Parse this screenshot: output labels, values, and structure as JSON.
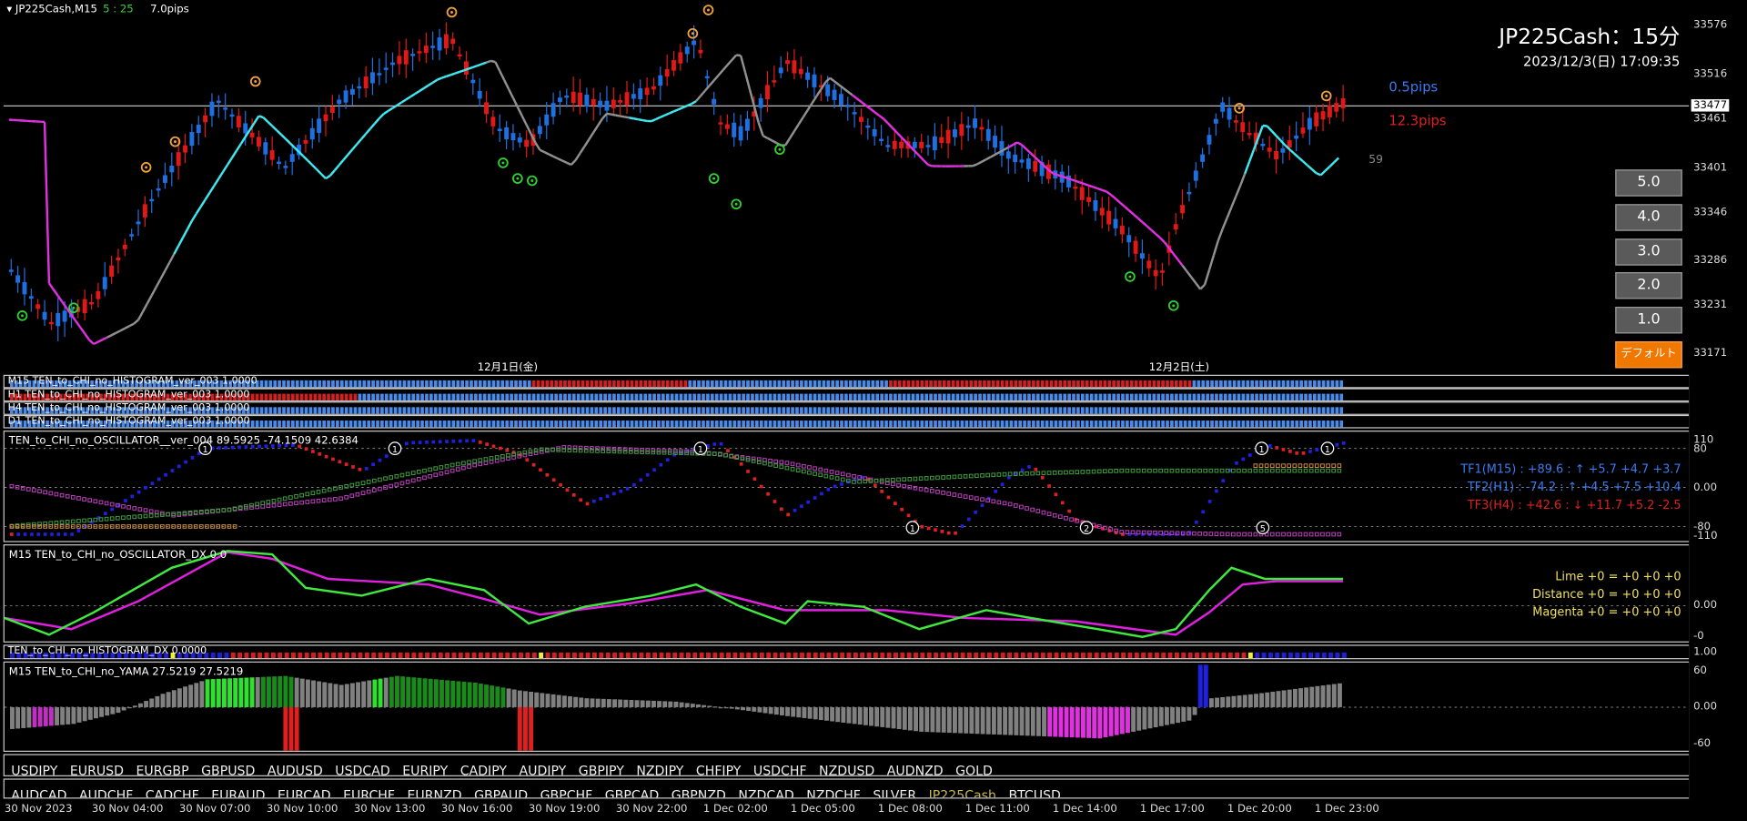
{
  "header": {
    "symbol_tf": "JP225Cash,M15",
    "count": "5 : 25",
    "pips": "7.0pips",
    "chart_title": "JP225Cash：15分",
    "datetime": "2023/12/3(日) 17:09:35",
    "spread_blue": "0.5pips",
    "range_red": "12.3pips",
    "countdown": "59"
  },
  "price_axis": {
    "ticks": [
      "33576",
      "33516",
      "33461",
      "33401",
      "33346",
      "33286",
      "33231",
      "33171"
    ],
    "current": "33477"
  },
  "date_labels": [
    "12月1日(金)",
    "12月2日(土)"
  ],
  "buttons": {
    "scale": [
      "5.0",
      "4.0",
      "3.0",
      "2.0",
      "1.0"
    ],
    "default": "デフォルト"
  },
  "histogram_rows": [
    "M15 TEN_to_CHI_no_HISTOGRAM_ver_003 1.0000",
    "H1 TEN_to_CHI_no_HISTOGRAM_ver_003 1.0000",
    "H4 TEN_to_CHI_no_HISTOGRAM_ver_003 1.0000",
    "D1 TEN_to_CHI_no_HISTOGRAM_ver_003 1.0000"
  ],
  "oscillator": {
    "label": "TEN_to_CHI_no_OSCILLATOR__ver_004 89.5925 -74.1509 42.6384",
    "axis": [
      "110",
      "80",
      "0.00",
      "-80",
      "-110"
    ],
    "tf1": "TF1(M15) : +89.6 : ↑ +5.7 +4.7 +3.7",
    "tf2": "TF2(H1) : -74.2 : ↑ +4.5 +7.5 +10.4",
    "tf3": "TF3(H4) : +42.6 : ↓ +11.7 +5.2 -2.5"
  },
  "oscillator_dx": {
    "label": "M15 TEN_to_CHI_no_OSCILLATOR_DX 0 0",
    "axis": [
      "0.00",
      "-0"
    ],
    "lime": "Lime +0 = +0 +0 +0",
    "distance": "Distance +0 = +0 +0 +0",
    "magenta": "Magenta +0 = +0 +0 +0"
  },
  "histogram_dx": {
    "label": "TEN_to_CHI_no_HISTOGRAM_DX 0.0000",
    "axis": "1.00"
  },
  "yama": {
    "label": "M15 TEN_to_CHI_no_YAMA 27.5219 27.5219",
    "axis": [
      "60",
      "0.00",
      "-60"
    ]
  },
  "symbols_row1": [
    "USDJPY",
    "EURUSD",
    "EURGBP",
    "GBPUSD",
    "AUDUSD",
    "USDCAD",
    "EURJPY",
    "CADJPY",
    "AUDJPY",
    "GBPJPY",
    "NZDJPY",
    "CHFJPY",
    "USDCHF",
    "NZDUSD",
    "AUDNZD",
    "GOLD"
  ],
  "symbols_row2": [
    "AUDCAD",
    "AUDCHF",
    "CADCHF",
    "EURAUD",
    "EURCAD",
    "EURCHF",
    "EURNZD",
    "GBPAUD",
    "GBPCHF",
    "GBPCAD",
    "GBPNZD",
    "NZDCAD",
    "NZDCHF",
    "SILVER",
    "JP225Cash",
    "BTCUSD"
  ],
  "active_symbol": "JP225Cash",
  "time_axis": [
    "30 Nov 2023",
    "30 Nov 04:00",
    "30 Nov 07:00",
    "30 Nov 10:00",
    "30 Nov 13:00",
    "30 Nov 16:00",
    "30 Nov 19:00",
    "30 Nov 22:00",
    "1 Dec 02:00",
    "1 Dec 05:00",
    "1 Dec 08:00",
    "1 Dec 11:00",
    "1 Dec 14:00",
    "1 Dec 17:00",
    "1 Dec 20:00",
    "1 Dec 23:00"
  ],
  "colors": {
    "bull": "#1e6fe0",
    "bear": "#e01818",
    "ma_cyan": "#40e8f0",
    "ma_gray": "#909090",
    "ma_magenta": "#e030e0",
    "lime": "#40e840",
    "orange_marker": "#f0a040",
    "green_marker": "#30d030",
    "button_orange": "#f07800"
  }
}
